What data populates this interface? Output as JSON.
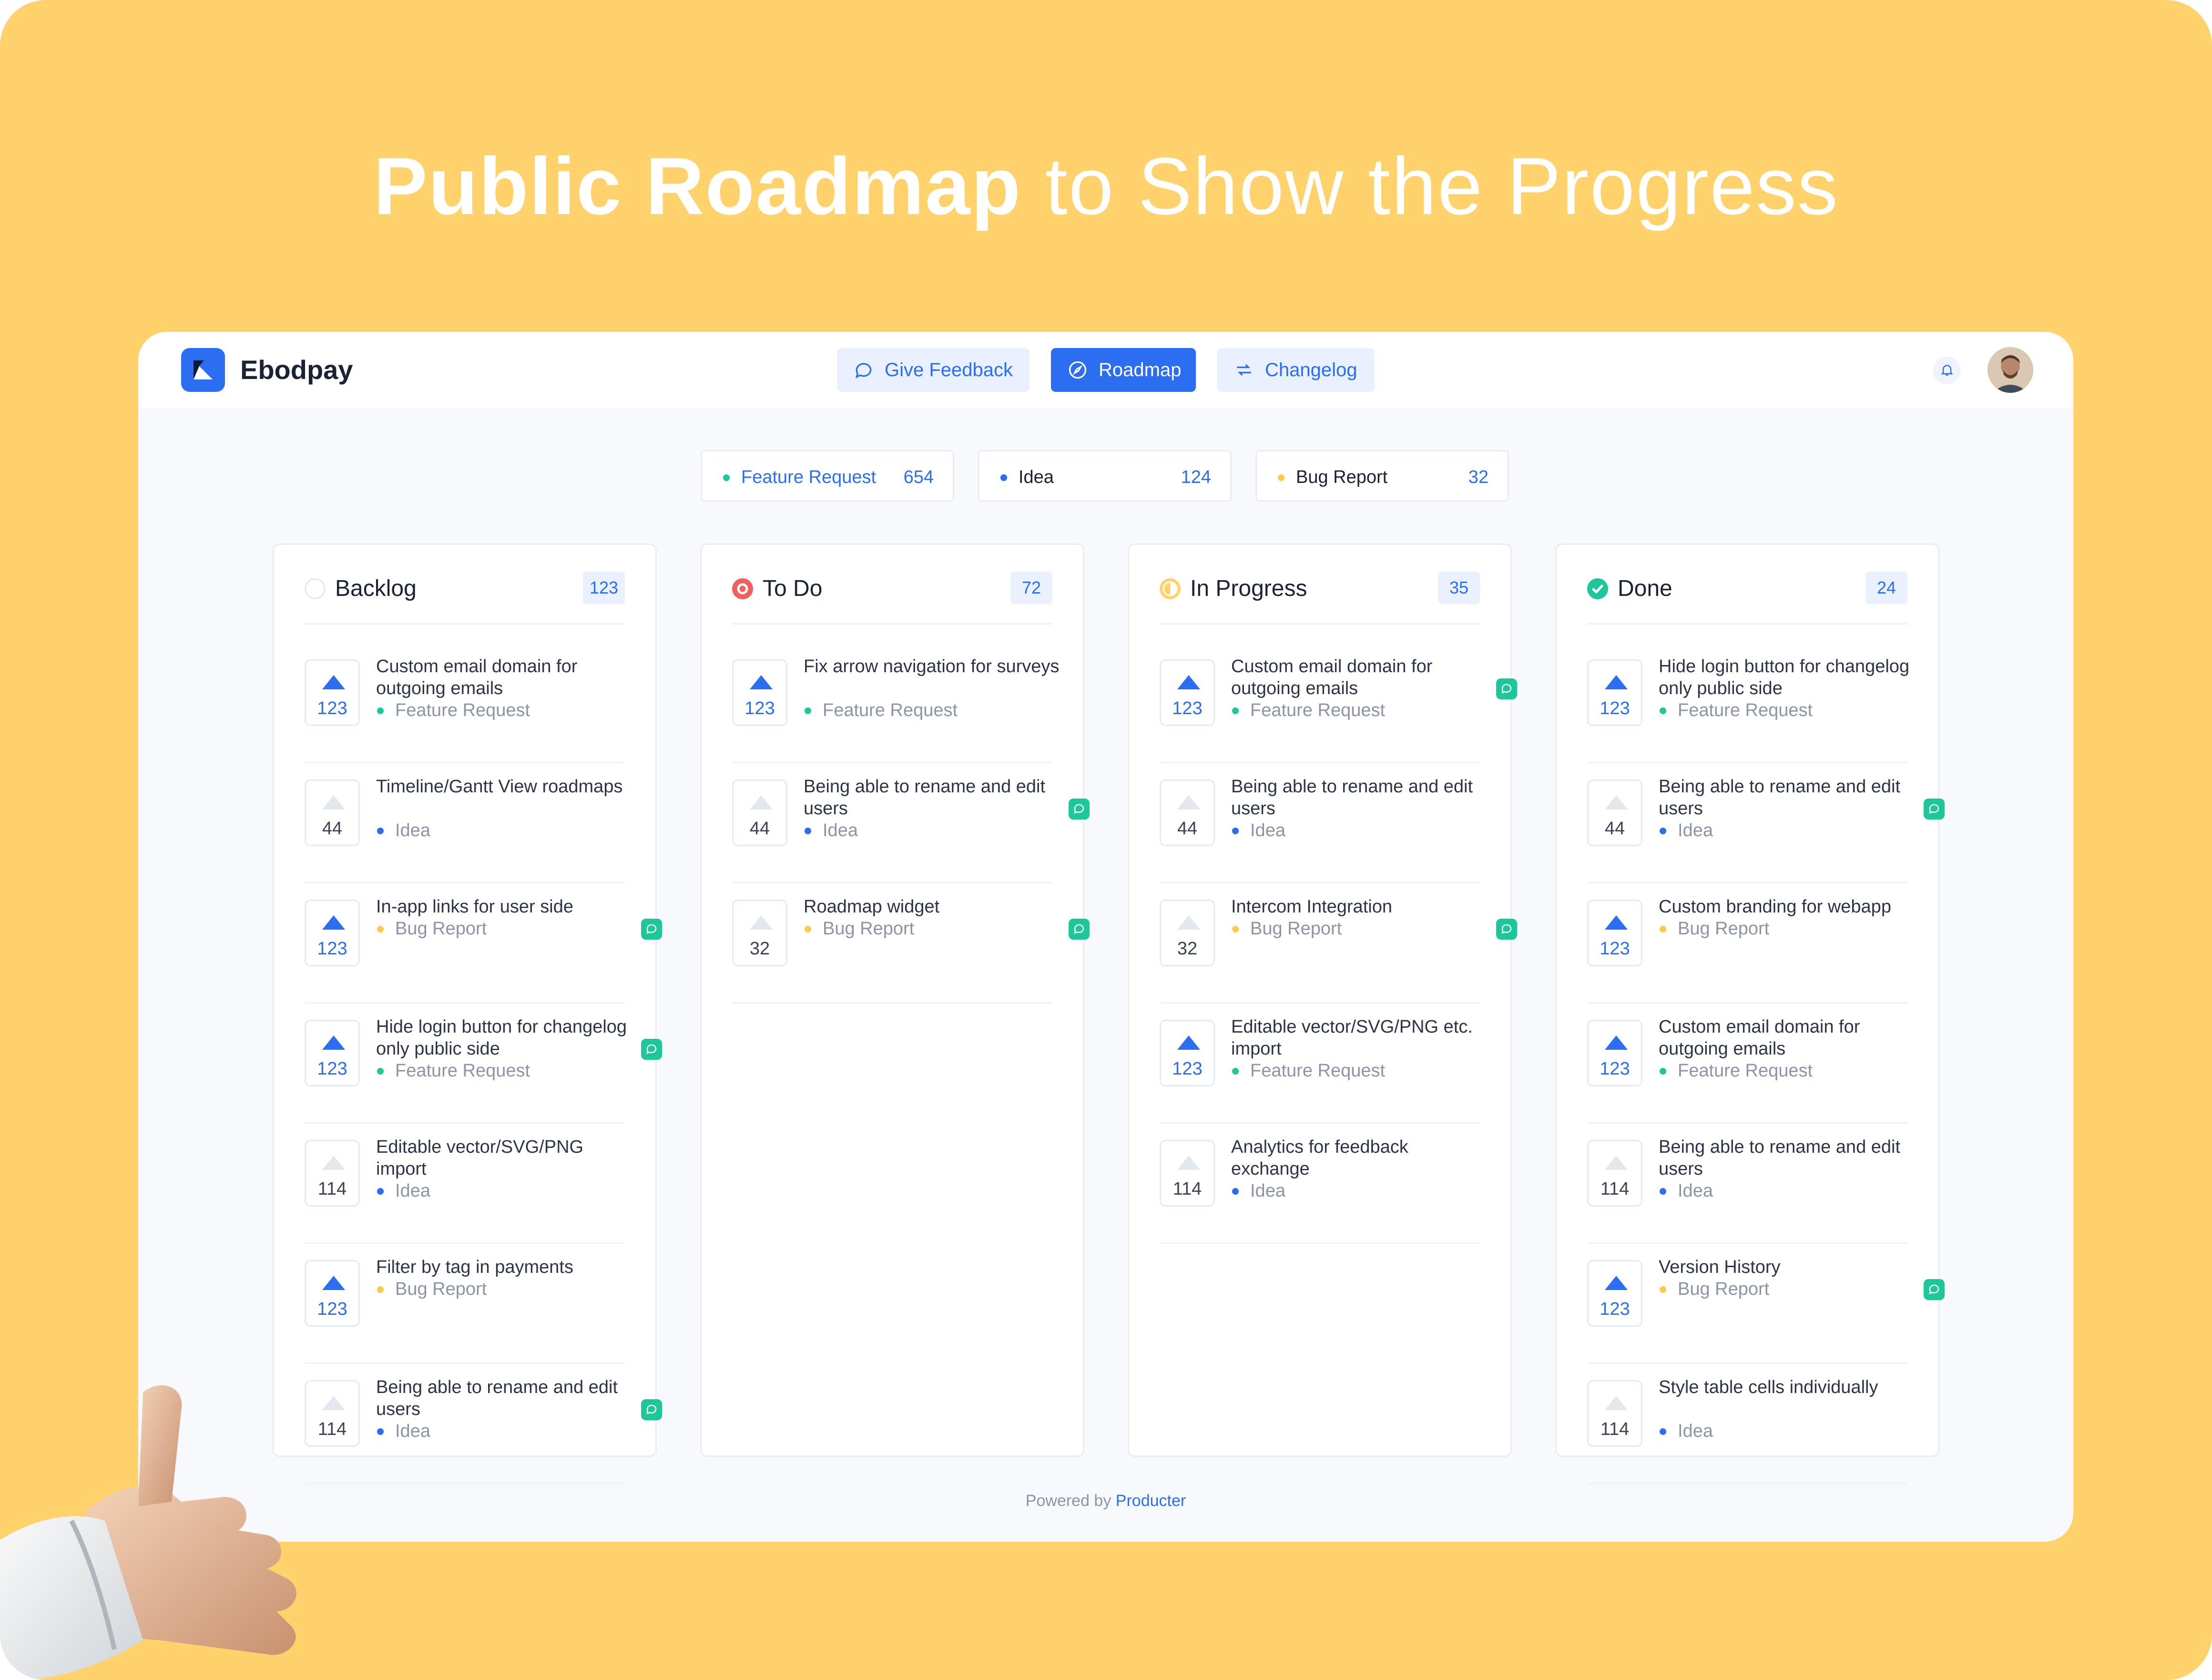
{
  "headline": {
    "bold": "Public Roadmap",
    "light": " to Show the Progress"
  },
  "brand": {
    "name": "Ebodpay",
    "logo_icon": "logo-mark",
    "accent": "#2b6ef2"
  },
  "nav": [
    {
      "label": "Give Feedback",
      "icon": "chat-bubble-icon",
      "active": false
    },
    {
      "label": "Roadmap",
      "icon": "compass-icon",
      "active": true
    },
    {
      "label": "Changelog",
      "icon": "refresh-icon",
      "active": false
    }
  ],
  "header_icons": {
    "bell": "bell-icon",
    "avatar": "user-avatar"
  },
  "filters": [
    {
      "label": "Feature Request",
      "count": "654",
      "color": "#1ec79a"
    },
    {
      "label": "Idea",
      "count": "124",
      "color": "#2b6ef2"
    },
    {
      "label": "Bug Report",
      "count": "32",
      "color": "#ffc94d"
    }
  ],
  "tag_colors": {
    "Feature Request": "#1ec79a",
    "Idea": "#2b6ef2",
    "Bug Report": "#ffc94d"
  },
  "columns": [
    {
      "title": "Backlog",
      "count": "123",
      "status": "backlog",
      "cards": [
        {
          "votes": "123",
          "voted": true,
          "title": "Custom email domain for outgoing emails",
          "tag": "Feature Request",
          "comment": false
        },
        {
          "votes": "44",
          "voted": false,
          "title": "Timeline/Gantt View roadmaps",
          "tag": "Idea",
          "comment": false
        },
        {
          "votes": "123",
          "voted": true,
          "title": "In-app links for user side",
          "tag": "Bug Report",
          "comment": true
        },
        {
          "votes": "123",
          "voted": true,
          "title": "Hide login button for changelog only public side",
          "tag": "Feature Request",
          "comment": true
        },
        {
          "votes": "114",
          "voted": false,
          "title": "Editable vector/SVG/PNG import",
          "tag": "Idea",
          "comment": false
        },
        {
          "votes": "123",
          "voted": true,
          "title": "Filter by tag in payments",
          "tag": "Bug Report",
          "comment": false
        },
        {
          "votes": "114",
          "voted": false,
          "title": "Being able to rename and edit users",
          "tag": "Idea",
          "comment": true
        }
      ]
    },
    {
      "title": "To Do",
      "count": "72",
      "status": "todo",
      "cards": [
        {
          "votes": "123",
          "voted": true,
          "title": "Fix arrow navigation for surveys",
          "tag": "Feature Request",
          "comment": false
        },
        {
          "votes": "44",
          "voted": false,
          "title": "Being able to rename and edit users",
          "tag": "Idea",
          "comment": true
        },
        {
          "votes": "32",
          "voted": false,
          "title": "Roadmap widget",
          "tag": "Bug Report",
          "comment": true
        }
      ]
    },
    {
      "title": "In Progress",
      "count": "35",
      "status": "in-progress",
      "cards": [
        {
          "votes": "123",
          "voted": true,
          "title": "Custom email domain for outgoing emails",
          "tag": "Feature Request",
          "comment": true
        },
        {
          "votes": "44",
          "voted": false,
          "title": "Being able to rename and edit users",
          "tag": "Idea",
          "comment": false
        },
        {
          "votes": "32",
          "voted": false,
          "title": "Intercom Integration",
          "tag": "Bug Report",
          "comment": true
        },
        {
          "votes": "123",
          "voted": true,
          "title": "Editable vector/SVG/PNG etc. import",
          "tag": "Feature Request",
          "comment": false
        },
        {
          "votes": "114",
          "voted": false,
          "title": "Analytics for feedback exchange",
          "tag": "Idea",
          "comment": false
        }
      ]
    },
    {
      "title": "Done",
      "count": "24",
      "status": "done",
      "cards": [
        {
          "votes": "123",
          "voted": true,
          "title": "Hide login button for changelog only public side",
          "tag": "Feature Request",
          "comment": false
        },
        {
          "votes": "44",
          "voted": false,
          "title": "Being able to rename and edit users",
          "tag": "Idea",
          "comment": true
        },
        {
          "votes": "123",
          "voted": true,
          "title": "Custom branding for webapp",
          "tag": "Bug Report",
          "comment": false
        },
        {
          "votes": "123",
          "voted": true,
          "title": "Custom email domain for outgoing emails",
          "tag": "Feature Request",
          "comment": false
        },
        {
          "votes": "114",
          "voted": false,
          "title": "Being able to rename and edit users",
          "tag": "Idea",
          "comment": false
        },
        {
          "votes": "123",
          "voted": true,
          "title": "Version History",
          "tag": "Bug Report",
          "comment": true
        },
        {
          "votes": "114",
          "voted": false,
          "title": "Style table cells individually",
          "tag": "Idea",
          "comment": false
        }
      ]
    }
  ],
  "footer": {
    "prefix": "Powered by ",
    "link": "Producter"
  }
}
